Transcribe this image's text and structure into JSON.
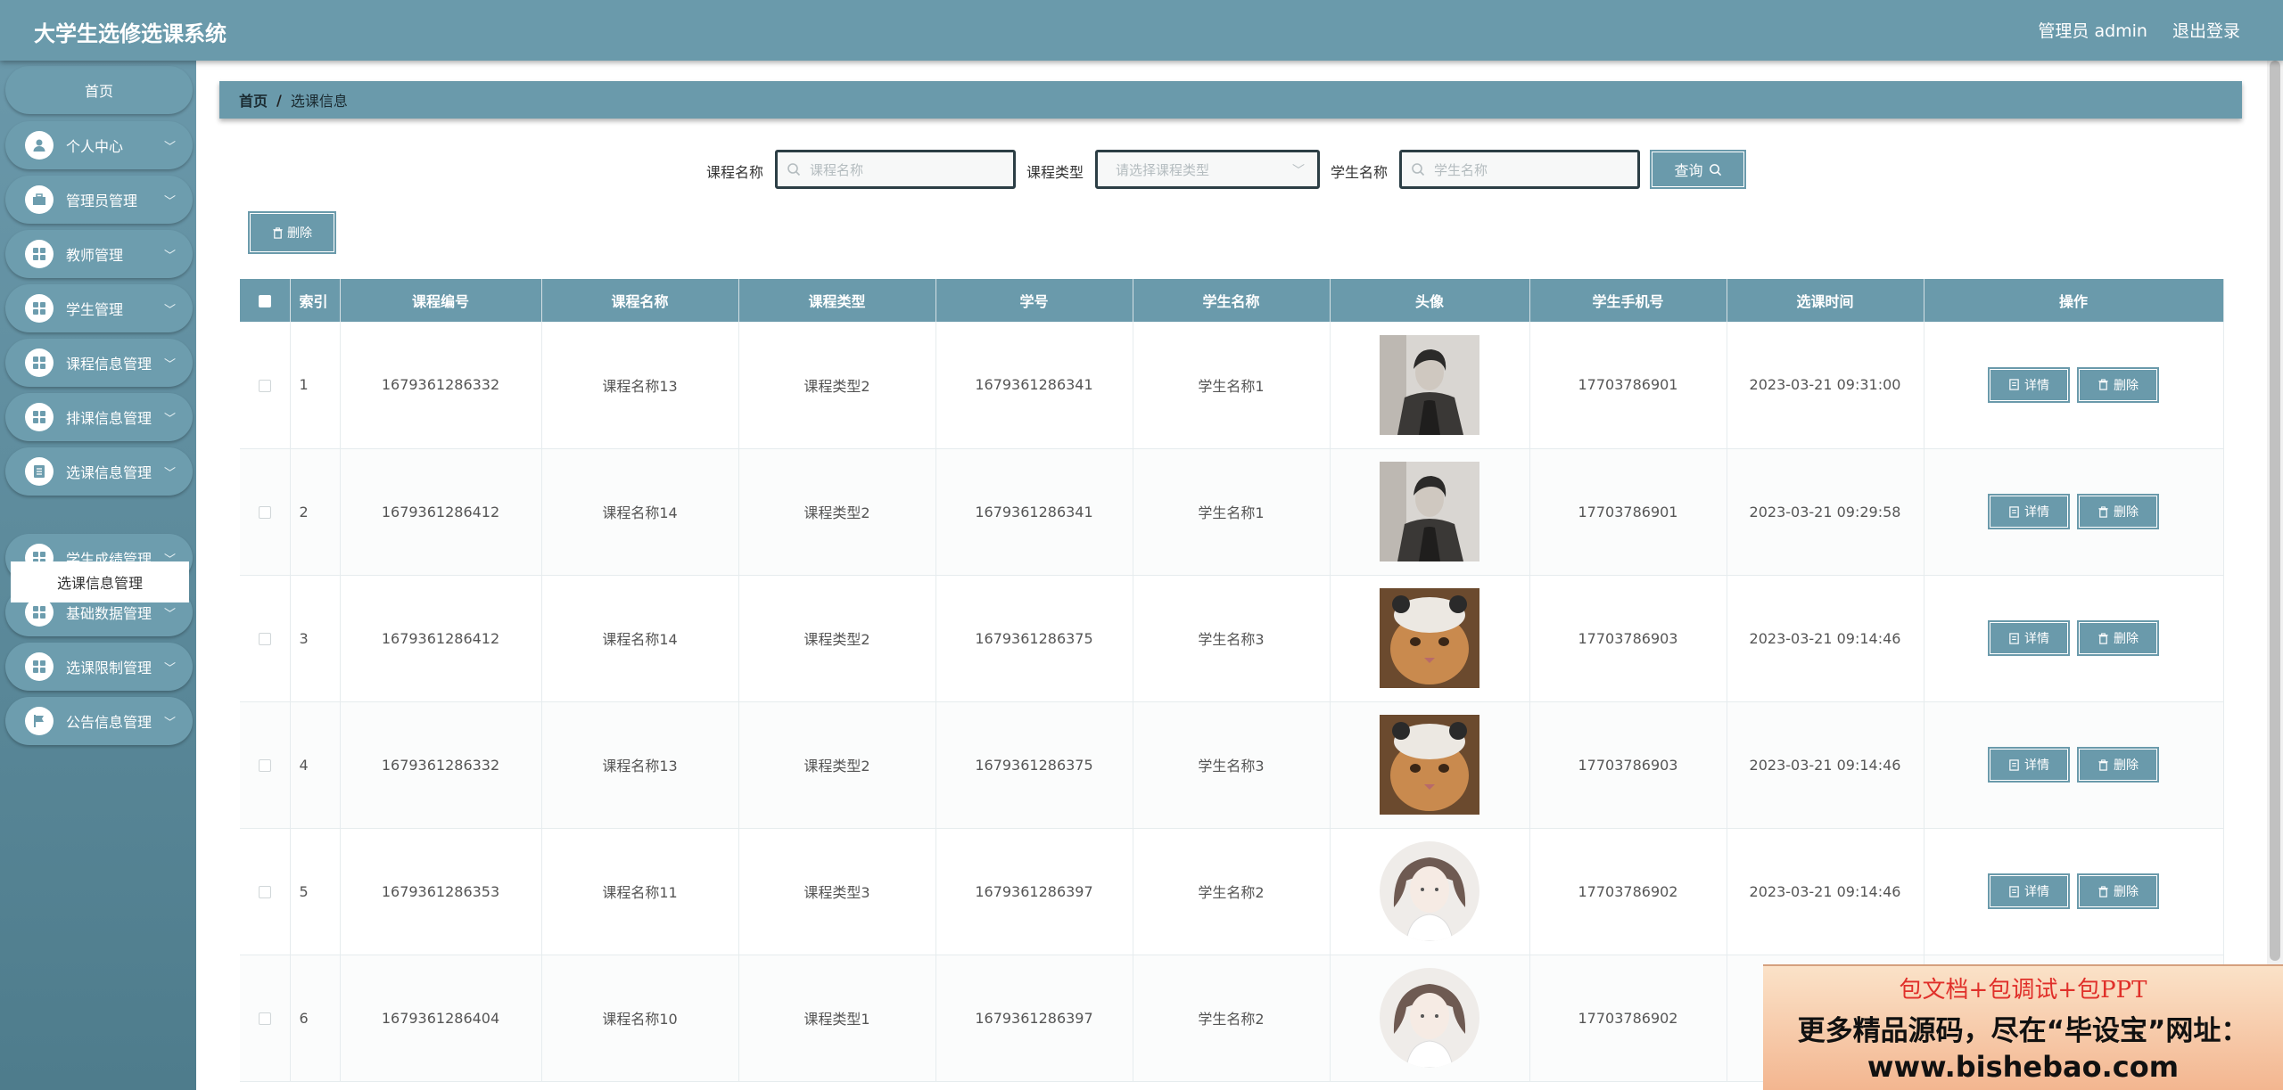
{
  "header": {
    "title": "大学生选修选课系统",
    "user": "管理员 admin",
    "logout": "退出登录"
  },
  "sidebar": {
    "home": "首页",
    "items": [
      {
        "label": "个人中心",
        "icon": "user-icon"
      },
      {
        "label": "管理员管理",
        "icon": "briefcase-icon"
      },
      {
        "label": "教师管理",
        "icon": "grid-icon"
      },
      {
        "label": "学生管理",
        "icon": "grid-icon"
      },
      {
        "label": "课程信息管理",
        "icon": "grid-icon"
      },
      {
        "label": "排课信息管理",
        "icon": "grid-icon"
      },
      {
        "label": "选课信息管理",
        "icon": "document-icon"
      },
      {
        "label": "学生成绩管理",
        "icon": "grid-icon"
      },
      {
        "label": "基础数据管理",
        "icon": "grid-icon"
      },
      {
        "label": "选课限制管理",
        "icon": "grid-icon"
      },
      {
        "label": "公告信息管理",
        "icon": "flag-icon"
      }
    ],
    "sub_active": "选课信息管理"
  },
  "breadcrumb": {
    "home": "首页",
    "sep": "/",
    "current": "选课信息"
  },
  "search": {
    "course_name_label": "课程名称",
    "course_name_placeholder": "课程名称",
    "course_type_label": "课程类型",
    "course_type_placeholder": "请选择课程类型",
    "student_name_label": "学生名称",
    "student_name_placeholder": "学生名称",
    "query_label": "查询"
  },
  "toolbar": {
    "delete_label": "删除"
  },
  "table": {
    "headers": [
      "索引",
      "课程编号",
      "课程名称",
      "课程类型",
      "学号",
      "学生名称",
      "头像",
      "学生手机号",
      "选课时间",
      "操作"
    ],
    "rows": [
      {
        "index": "1",
        "course_no": "1679361286332",
        "course_name": "课程名称13",
        "course_type": "课程类型2",
        "student_no": "1679361286341",
        "student_name": "学生名称1",
        "avatar": "man",
        "phone": "17703786901",
        "time": "2023-03-21 09:31:00"
      },
      {
        "index": "2",
        "course_no": "1679361286412",
        "course_name": "课程名称14",
        "course_type": "课程类型2",
        "student_no": "1679361286341",
        "student_name": "学生名称1",
        "avatar": "man",
        "phone": "17703786901",
        "time": "2023-03-21 09:29:58"
      },
      {
        "index": "3",
        "course_no": "1679361286412",
        "course_name": "课程名称14",
        "course_type": "课程类型2",
        "student_no": "1679361286375",
        "student_name": "学生名称3",
        "avatar": "cat",
        "phone": "17703786903",
        "time": "2023-03-21 09:14:46"
      },
      {
        "index": "4",
        "course_no": "1679361286332",
        "course_name": "课程名称13",
        "course_type": "课程类型2",
        "student_no": "1679361286375",
        "student_name": "学生名称3",
        "avatar": "cat",
        "phone": "17703786903",
        "time": "2023-03-21 09:14:46"
      },
      {
        "index": "5",
        "course_no": "1679361286353",
        "course_name": "课程名称11",
        "course_type": "课程类型3",
        "student_no": "1679361286397",
        "student_name": "学生名称2",
        "avatar": "girl",
        "phone": "17703786902",
        "time": "2023-03-21 09:14:46"
      },
      {
        "index": "6",
        "course_no": "1679361286404",
        "course_name": "课程名称10",
        "course_type": "课程类型1",
        "student_no": "1679361286397",
        "student_name": "学生名称2",
        "avatar": "girl",
        "phone": "17703786902",
        "time": "2"
      }
    ],
    "detail_label": "详情",
    "delete_label": "删除"
  },
  "ad": {
    "line1": "包文档+包调试+包PPT",
    "line2": "更多精品源码，尽在“毕设宝”网址：",
    "line3": "www.bishebao.com"
  },
  "colors": {
    "primary": "#6a9aab",
    "sidebar_dark": "#4e7c8c",
    "ad_red": "#e0302a"
  }
}
